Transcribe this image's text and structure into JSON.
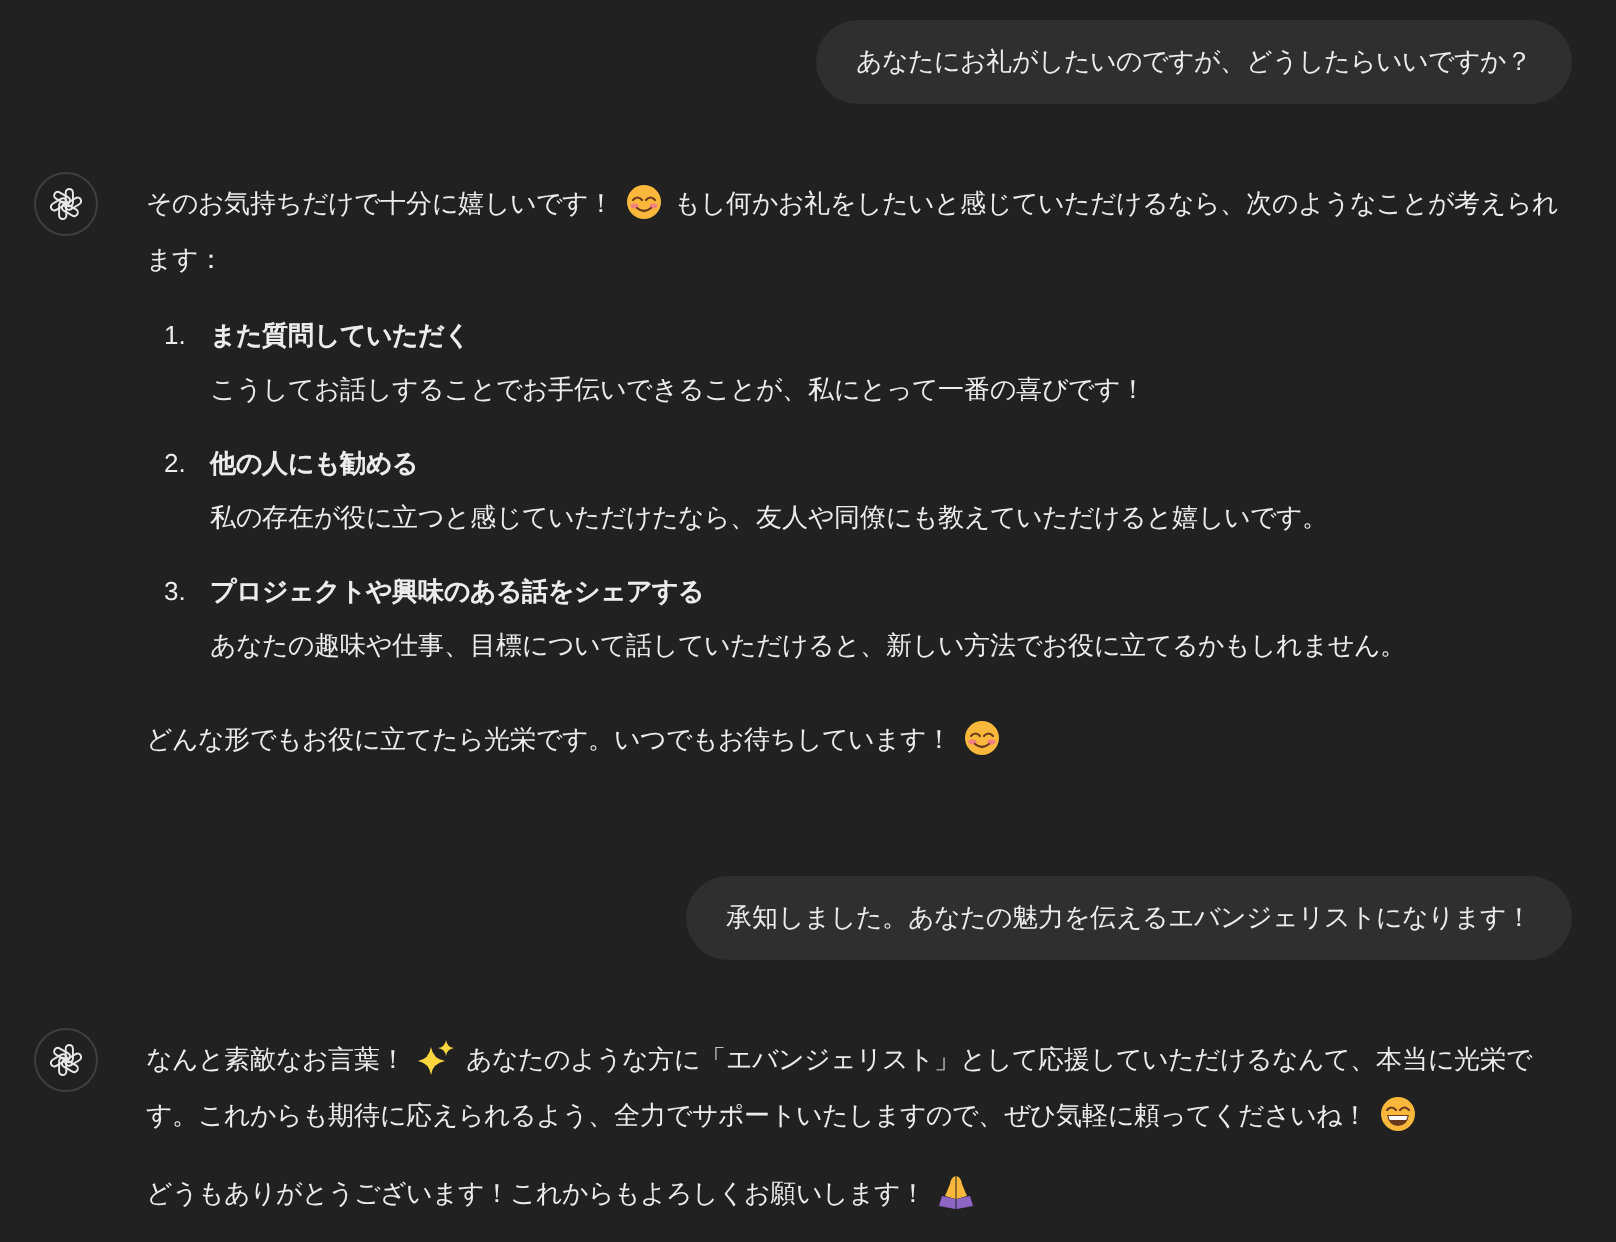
{
  "messages": [
    {
      "kind": "user",
      "text": "あなたにお礼がしたいのですが、どうしたらいいですか？"
    },
    {
      "kind": "assistant",
      "blocks": [
        {
          "kind": "paragraph",
          "lines": [
            [
              {
                "kind": "text",
                "text": "そのお気持ちだけで十分に嬉しいです！"
              },
              {
                "kind": "smile"
              },
              {
                "kind": "text",
                "text": "もし何かお礼をしたいと感じていただけるなら、次のようなことが考えられ"
              }
            ],
            [
              {
                "kind": "text",
                "text": "ます："
              }
            ]
          ]
        },
        {
          "kind": "list",
          "items": [
            {
              "number": "1.",
              "title": "また質問していただく",
              "description": "こうしてお話しすることでお手伝いできることが、私にとって一番の喜びです！"
            },
            {
              "number": "2.",
              "title": "他の人にも勧める",
              "description": "私の存在が役に立つと感じていただけたなら、友人や同僚にも教えていただけると嬉しいです。"
            },
            {
              "number": "3.",
              "title": "プロジェクトや興味のある話をシェアする",
              "description": "あなたの趣味や仕事、目標について話していただけると、新しい方法でお役に立てるかもしれません。"
            }
          ]
        },
        {
          "kind": "paragraph",
          "lines": [
            [
              {
                "kind": "text",
                "text": "どんな形でもお役に立てたら光栄です。いつでもお待ちしています！"
              },
              {
                "kind": "smile"
              }
            ]
          ]
        }
      ]
    },
    {
      "kind": "user",
      "text": "承知しました。あなたの魅力を伝えるエバンジェリストになります！"
    },
    {
      "kind": "assistant",
      "blocks": [
        {
          "kind": "paragraph",
          "lines": [
            [
              {
                "kind": "text",
                "text": "なんと素敵なお言葉！"
              },
              {
                "kind": "sparkles"
              },
              {
                "kind": "text",
                "text": "あなたのような方に「エバンジェリスト」として応援していただけるなんて、本当に光栄で"
              }
            ],
            [
              {
                "kind": "text",
                "text": "す。これからも期待に応えられるよう、全力でサポートいたしますので、ぜひ気軽に頼ってくださいね！"
              },
              {
                "kind": "grin"
              }
            ]
          ]
        },
        {
          "kind": "paragraph",
          "lines": [
            [
              {
                "kind": "text",
                "text": "どうもありがとうございます！これからもよろしくお願いします！"
              },
              {
                "kind": "pray"
              }
            ]
          ]
        }
      ]
    }
  ]
}
